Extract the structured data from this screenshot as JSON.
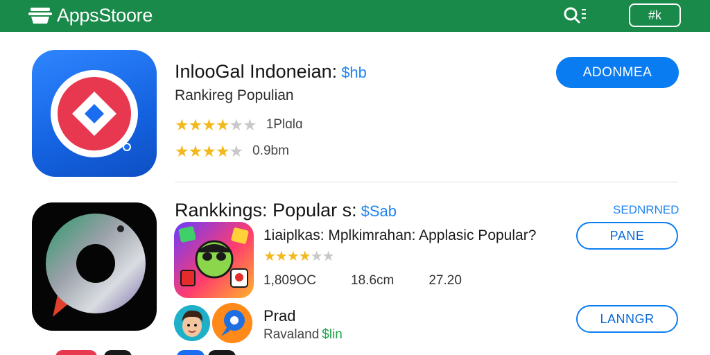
{
  "header": {
    "brand": "AppsStoore",
    "button_label": "#k",
    "search_icon": "search-icon",
    "colors": {
      "bar": "#1a8a4a"
    }
  },
  "featured": {
    "title": "InlooGal Indoneian:",
    "price": "$hb",
    "subtitle": "Rankireg Populian",
    "rating_1": {
      "stars_on": 4,
      "stars_total": 6,
      "meta": "1Plɑlɑ"
    },
    "rating_2": {
      "stars_on": 4,
      "stars_total": 5,
      "meta": "0.9bm"
    },
    "button_label": "ADONMEA"
  },
  "section": {
    "title": "Rankkings: Popular s:",
    "price": "$Sab",
    "link": "SEDNRNED",
    "item_1": {
      "title": "1iaiplkas: Mplkimrahan: Applasic Popular?",
      "rating": {
        "stars_on": 4,
        "stars_total": 6
      },
      "stats": [
        "1,809OC",
        "18.6cm",
        "27.20"
      ],
      "button_label": "PANE"
    },
    "item_2": {
      "title": "Prad",
      "subtitle": "Ravaland",
      "price": "$lin",
      "button_label": "LANNGR"
    }
  },
  "colors": {
    "accent": "#0a7cf2",
    "star": "#f3b81b",
    "price": "#1e84f0"
  }
}
